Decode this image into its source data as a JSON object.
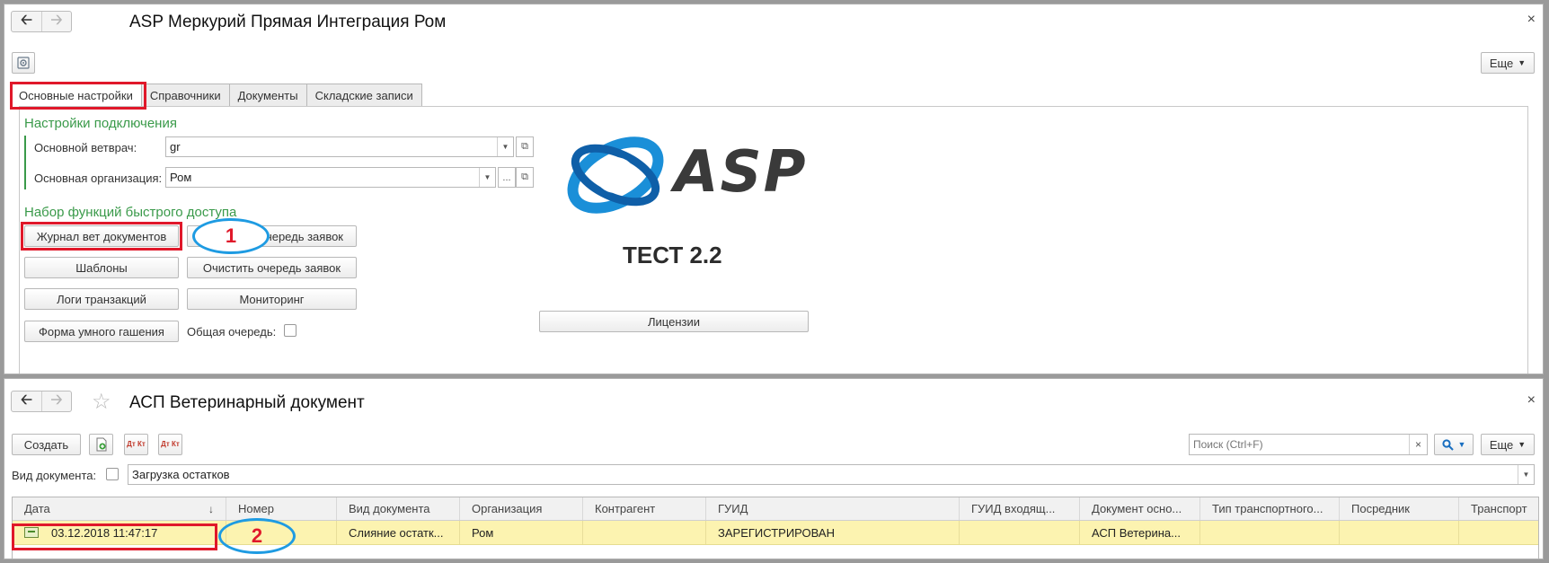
{
  "window1": {
    "title": "ASP Меркурий Прямая Интеграция Ром",
    "back_icon": "arrow-left-icon",
    "forward_icon": "arrow-right-icon",
    "close_glyph": "×",
    "settings_icon": "gear-icon",
    "more_label": "Еще",
    "tabs": [
      {
        "label": "Основные настройки",
        "active": true
      },
      {
        "label": "Справочники",
        "active": false
      },
      {
        "label": "Документы",
        "active": false
      },
      {
        "label": "Складские записи",
        "active": false
      }
    ],
    "connection": {
      "heading": "Настройки подключения",
      "vet_label": "Основной ветврач:",
      "vet_value": "gr",
      "org_label": "Основная организация:",
      "org_value": "Ром",
      "ellipsis": "..."
    },
    "quick": {
      "heading": "Набор функций быстрого доступа",
      "buttons": [
        "Журнал вет документов",
        "Очередь заявок",
        "Шаблоны",
        "Очистить очередь заявок",
        "Логи транзакций",
        "Мониторинг",
        "Форма умного гашения"
      ],
      "shared_queue_label": "Общая очередь:",
      "shared_queue_checked": false
    },
    "logo_text": "ASP",
    "version_text": "ТЕСТ 2.2",
    "license_label": "Лицензии"
  },
  "window2": {
    "title": "АСП Ветеринарный документ",
    "favorite_icon": "star-icon",
    "close_glyph": "×",
    "create_label": "Создать",
    "dt_kt_label": "Дт Кт",
    "search_placeholder": "Поиск (Ctrl+F)",
    "clear_glyph": "×",
    "search_icon": "search-icon",
    "more_label": "Еще",
    "doc_type_label": "Вид документа:",
    "doc_type_checked": false,
    "doc_type_value": "Загрузка остатков",
    "columns": [
      "Дата",
      "Номер",
      "Вид документа",
      "Организация",
      "Контрагент",
      "ГУИД",
      "ГУИД входящ...",
      "Документ осно...",
      "Тип транспортного...",
      "Посредник",
      "Транспорт"
    ],
    "sort_glyph": "↓",
    "rows": [
      [
        "03.12.2018 11:47:17",
        "",
        "Слияние остатк...",
        "Ром",
        "",
        "ЗАРЕГИСТРИРОВАН",
        "",
        "АСП Ветерина...",
        "",
        "",
        ""
      ]
    ]
  },
  "annotations": {
    "marker1": "1",
    "marker2": "2"
  },
  "colors": {
    "section_green": "#3a9a4a",
    "annotation_red": "#e0182a",
    "annotation_blue": "#1e9be2",
    "row_highlight": "#fcf3b0"
  }
}
